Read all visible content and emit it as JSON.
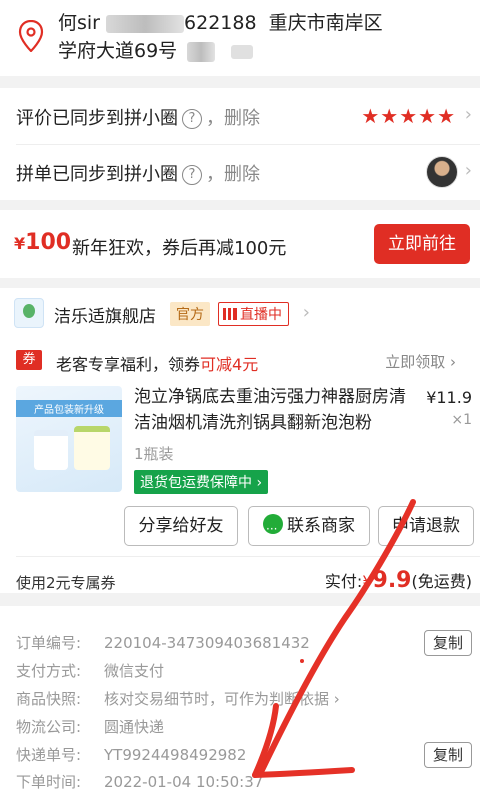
{
  "address": {
    "line1_name": "何sir",
    "line1_phone_tail": "622188",
    "line1_region": "重庆市南岸区",
    "line2": "学府大道69号"
  },
  "sync": {
    "review_text": "评价已同步到拼小圈",
    "review_delete": "，删除",
    "review_stars": "★★★★★",
    "group_text": "拼单已同步到拼小圈",
    "group_delete": "，删除",
    "help_symbol": "?",
    "chevron": "›"
  },
  "promo": {
    "yen": "¥",
    "amount": "100",
    "text": "新年狂欢，券后再减100元",
    "button": "立即前往"
  },
  "shop": {
    "name": "洁乐适旗舰店",
    "official_tag": "官方",
    "live_tag": "直播中",
    "coupon_icon": "券",
    "coupon_text_a": "老客专享福利，领券",
    "coupon_text_b": "可减4元",
    "coupon_get": "立即领取 ›",
    "image_banner": "产品包装新升级",
    "product_title": "泡立净锅底去重油污强力神器厨房清洁油烟机清洗剂锅具翻新泡泡粉",
    "price": "¥11.9",
    "qty": "×1",
    "spec": "1瓶装",
    "guarantee": "退货包运费保障中 ›",
    "btn_share": "分享给好友",
    "btn_contact": "联系商家",
    "btn_refund": "申请退款",
    "coupon_used": "使用2元专属券",
    "paid_label": "实付:",
    "paid_yen": "¥",
    "paid_amount": "9.9",
    "paid_note": "(免运费)"
  },
  "order": {
    "rows": [
      {
        "k": "订单编号:",
        "v": "220104-347309403681432",
        "copy": "复制"
      },
      {
        "k": "支付方式:",
        "v": "微信支付"
      },
      {
        "k": "商品快照:",
        "v": "核对交易细节时，可作为判断依据 ›"
      },
      {
        "k": "物流公司:",
        "v": "圆通快递"
      },
      {
        "k": "快递单号:",
        "v": "YT9924498492982",
        "copy": "复制"
      },
      {
        "k": "下单时间:",
        "v": "2022-01-04 10:50:37"
      }
    ]
  },
  "colors": {
    "accent": "#e02e24",
    "guarantee_green": "#16a34a",
    "annotation_arrow": "#e53127"
  },
  "icons": {
    "location": "location-pin-icon",
    "help": "question-mark-icon",
    "wechat": "wechat-icon",
    "live": "live-bars-icon"
  }
}
